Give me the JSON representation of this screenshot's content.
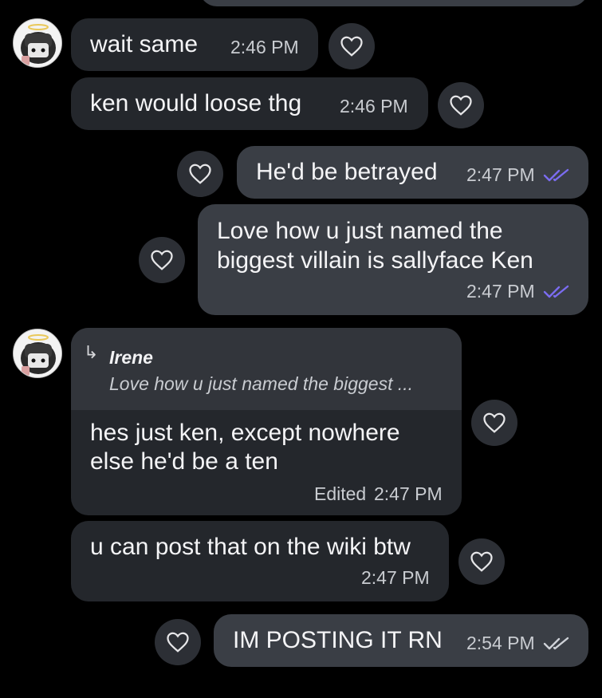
{
  "colors": {
    "incoming": "#24272c",
    "outgoing": "#3a3e45",
    "read_check": "#7b6cf0",
    "sent_check": "#cfd2d8"
  },
  "messages": [
    {
      "text": "wait same",
      "time": "2:46 PM"
    },
    {
      "text": "ken would loose thg",
      "time": "2:46 PM"
    },
    {
      "text": "He'd be betrayed",
      "time": "2:47 PM",
      "status": "read"
    },
    {
      "line1": "Love how u just named the",
      "line2": "biggest villain is sallyface Ken",
      "time": "2:47 PM",
      "status": "read"
    },
    {
      "reply": {
        "author": "Irene",
        "preview": "Love how u just named the biggest ..."
      },
      "line1": "hes just ken, except nowhere",
      "line2": "else he'd be a ten",
      "edited": "Edited",
      "time": "2:47 PM"
    },
    {
      "text": "u can post that on the wiki btw",
      "time": "2:47 PM"
    },
    {
      "text": "IM POSTING IT RN",
      "time": "2:54 PM",
      "status": "sent"
    }
  ],
  "icons": {
    "react": "heart-outline-icon",
    "reply": "reply-arrow-icon",
    "read": "double-check-icon"
  }
}
